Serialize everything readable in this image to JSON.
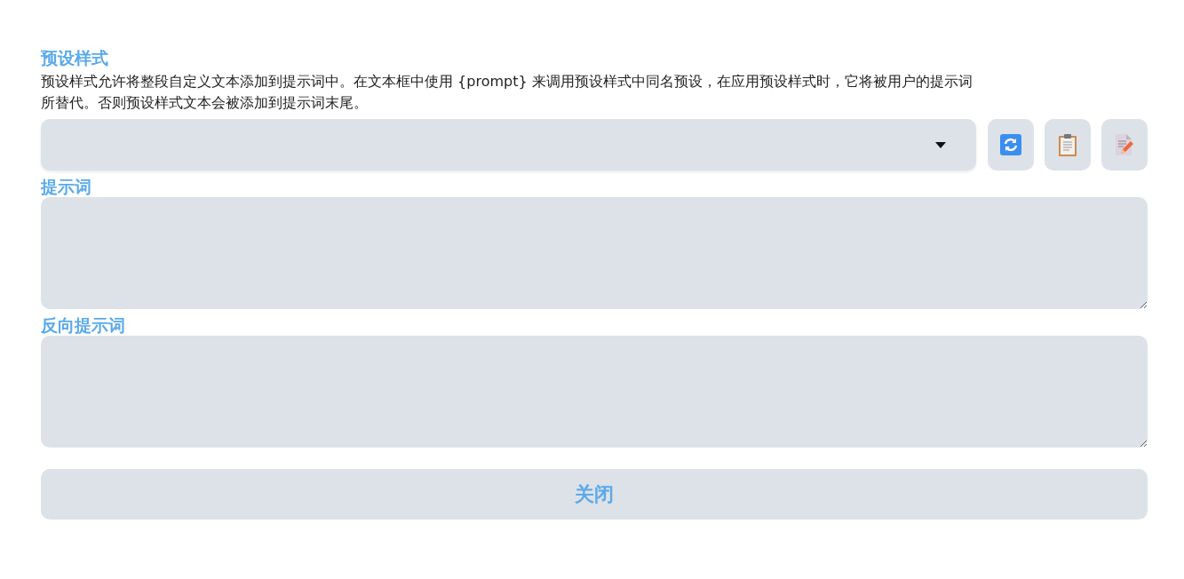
{
  "preset": {
    "title": "预设样式",
    "description": "预设样式允许将整段自定义文本添加到提示词中。在文本框中使用 {prompt} 来调用预设样式中同名预设，在应用预设样式时，它将被用户的提示词所替代。否则预设样式文本会被添加到提示词末尾。"
  },
  "prompt": {
    "label": "提示词"
  },
  "negative_prompt": {
    "label": "反向提示词"
  },
  "buttons": [
    "关闭"
  ]
}
